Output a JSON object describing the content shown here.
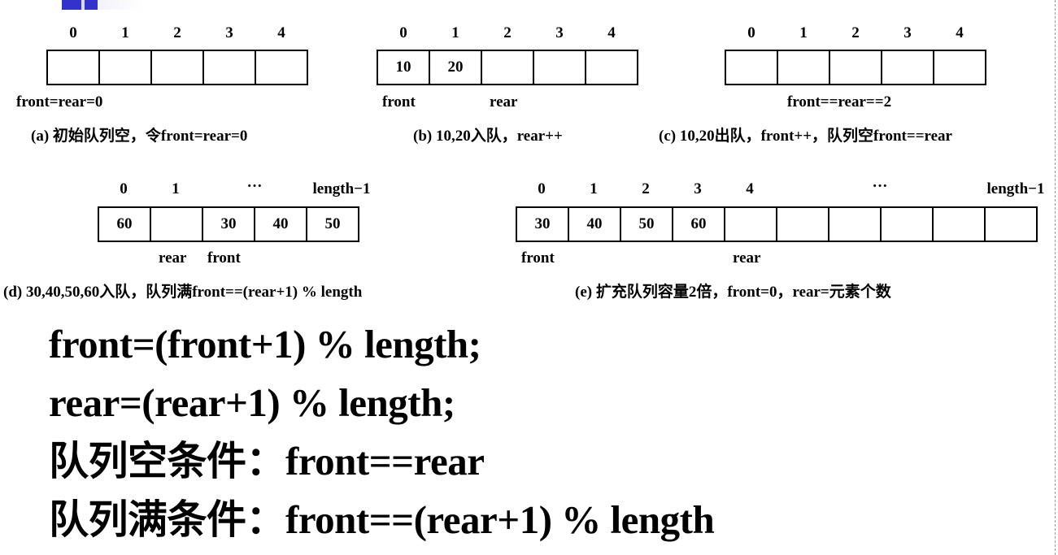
{
  "diagrams": {
    "a": {
      "indices": [
        "0",
        "1",
        "2",
        "3",
        "4"
      ],
      "cells": [
        "",
        "",
        "",
        "",
        ""
      ],
      "labels": [
        "front=rear=0"
      ],
      "caption": "(a) 初始队列空，令front=rear=0"
    },
    "b": {
      "indices": [
        "0",
        "1",
        "2",
        "3",
        "4"
      ],
      "cells": [
        "10",
        "20",
        "",
        "",
        ""
      ],
      "labels": [
        "front",
        "rear"
      ],
      "caption": "(b) 10,20入队，rear++"
    },
    "c": {
      "indices": [
        "0",
        "1",
        "2",
        "3",
        "4"
      ],
      "cells": [
        "",
        "",
        "",
        "",
        ""
      ],
      "labels": [
        "front==rear==2"
      ],
      "caption": "(c) 10,20出队，front++，队列空front==rear"
    },
    "d": {
      "indices": [
        "0",
        "1",
        "···",
        "length−1"
      ],
      "cells": [
        "60",
        "",
        "30",
        "40",
        "50"
      ],
      "labels": [
        "rear",
        "front"
      ],
      "caption": "(d) 30,40,50,60入队，队列满front==(rear+1) % length"
    },
    "e": {
      "indices": [
        "0",
        "1",
        "2",
        "3",
        "4",
        "···",
        "length−1"
      ],
      "cells": [
        "30",
        "40",
        "50",
        "60",
        "",
        "",
        "",
        "",
        "",
        ""
      ],
      "labels": [
        "front",
        "rear"
      ],
      "caption": "(e) 扩充队列容量2倍，front=0，rear=元素个数"
    }
  },
  "formulas": [
    "front=(front+1) % length;",
    "rear=(rear+1) % length;",
    "队列空条件：front==rear",
    "队列满条件：front==(rear+1) % length"
  ],
  "colors": {
    "accent": "#3333cc",
    "accent_light": "#d8d8f0"
  }
}
